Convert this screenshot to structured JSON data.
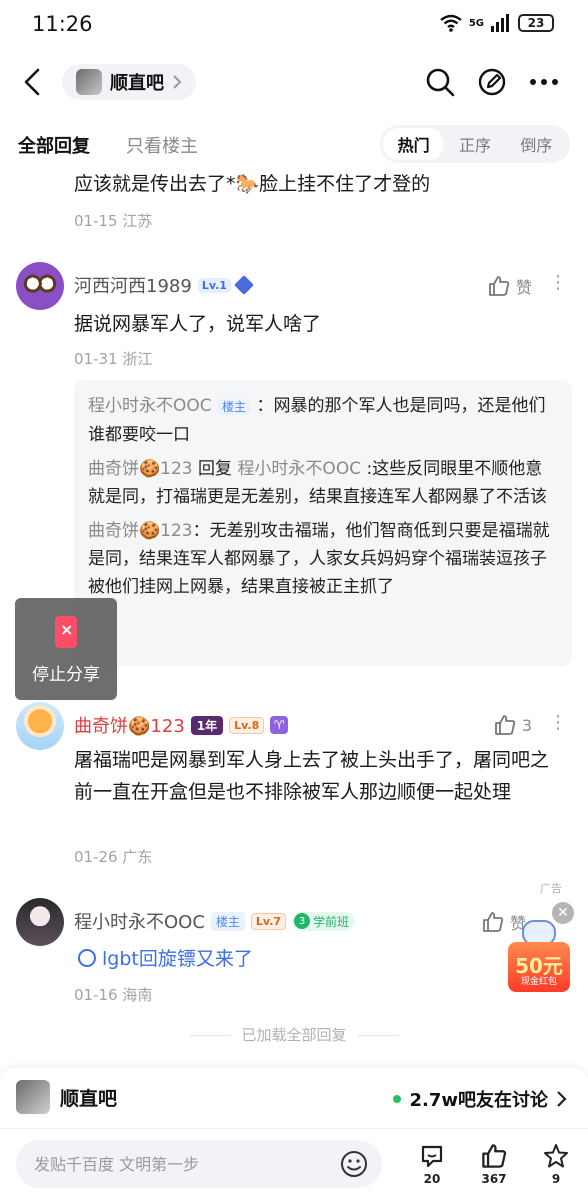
{
  "status_bar": {
    "time": "11:26",
    "network": "5G",
    "battery": "23"
  },
  "navbar": {
    "forum_name": "顺直吧"
  },
  "tabs": {
    "all_replies": "全部回复",
    "owner_only": "只看楼主",
    "sort": [
      "热门",
      "正序",
      "倒序"
    ]
  },
  "top_partial": {
    "text": "应该就是传出去了*🐎脸上挂不住了才登的",
    "meta": "01-15 江苏"
  },
  "comments": [
    {
      "username": "河西河西1989",
      "level": "Lv.1",
      "like_label": "赞",
      "text": "据说网暴军人了，说军人啥了",
      "meta": "01-31 浙江",
      "replies": [
        {
          "name": "程小时永不OOC",
          "tag": "楼主",
          "text": "：网暴的那个军人也是同吗，还是他们谁都要咬一口"
        },
        {
          "name": "曲奇饼🍪123",
          "reply_word": "回复",
          "reply_to": "程小时永不OOC",
          "text": " :这些反同眼里不顺他意就是同，打福瑞更是无差别，结果直接连军人都网暴了不活该"
        },
        {
          "name": "曲奇饼🍪123",
          "text": "：无差别攻击福瑞，他们智商低到只要是福瑞就是同，结果连军人都网暴了，人家女兵妈妈穿个福瑞装逗孩子被他们挂网上网暴，结果直接被正主抓了"
        }
      ]
    },
    {
      "username": "曲奇饼🍪123",
      "year_badge": "1年",
      "level": "Lv.8",
      "zodiac": "♈",
      "like_count": "3",
      "text": "屠福瑞吧是网暴到军人身上去了被上头出手了，屠同吧之前一直在开盒但是也不排除被军人那边顺便一起处理",
      "meta": "01-26 广东"
    },
    {
      "username": "程小时永不OOC",
      "owner_tag": "楼主",
      "level": "Lv.7",
      "grade_num": "3",
      "grade": "学前班",
      "like_label": "赞",
      "link_text": "lgbt回旋镖又来了",
      "meta": "01-16 海南"
    }
  ],
  "floating_share": {
    "label": "停止分享"
  },
  "ad": {
    "label": "广告",
    "amount": "50元",
    "sub": "现金红包"
  },
  "loaded_all": "已加载全部回复",
  "bottom_bar": {
    "forum_name": "顺直吧",
    "discussion": "2.7w吧友在讨论",
    "input_placeholder": "发贴千百度 文明第一步",
    "comments_count": "20",
    "likes_count": "367",
    "favorites_count": "9"
  },
  "colors": {
    "accent_blue": "#3d6fe8",
    "red_name": "#e03e3e",
    "online_green": "#22c35e"
  }
}
